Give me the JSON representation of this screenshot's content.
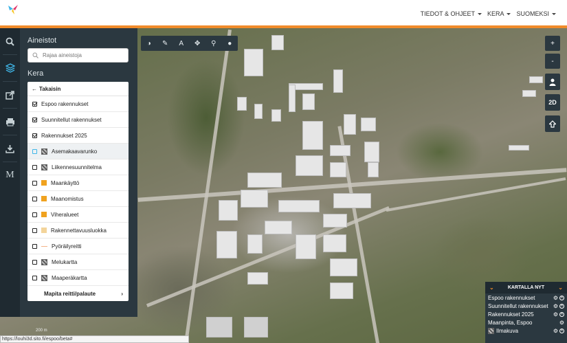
{
  "header": {
    "nav": [
      {
        "label": "TIEDOT & OHJEET"
      },
      {
        "label": "KERA"
      },
      {
        "label": "SUOMEKSI"
      }
    ],
    "accent_color": "#f18b2a"
  },
  "rail": {
    "items": [
      {
        "icon": "search-icon"
      },
      {
        "icon": "layers-icon",
        "active": true
      },
      {
        "icon": "share-icon"
      },
      {
        "icon": "print-icon"
      },
      {
        "icon": "download-icon"
      },
      {
        "icon": "metadata-icon",
        "glyph": "M"
      }
    ]
  },
  "panel": {
    "title": "Aineistot",
    "search_placeholder": "Rajaa aineistoja",
    "section": "Kera",
    "back_label": "Takaisin",
    "items": [
      {
        "label": "Espoo rakennukset",
        "checked": true,
        "legend": "none"
      },
      {
        "label": "Suunnitellut rakennukset",
        "checked": true,
        "legend": "none"
      },
      {
        "label": "Rakennukset 2025",
        "checked": true,
        "legend": "none"
      },
      {
        "label": "Asemakaavarunko",
        "checked": false,
        "legend": "image"
      },
      {
        "label": "Liikennesuunnitelma",
        "checked": false,
        "legend": "image"
      },
      {
        "label": "Maankäyttö",
        "checked": false,
        "legend": "swatch",
        "color": "#f0a21f"
      },
      {
        "label": "Maanomistus",
        "checked": false,
        "legend": "swatch",
        "color": "#f0a21f"
      },
      {
        "label": "Viheralueet",
        "checked": false,
        "legend": "swatch",
        "color": "#f0a21f"
      },
      {
        "label": "Rakennettavuusluokka",
        "checked": false,
        "legend": "swatch",
        "color": "#f3d49a"
      },
      {
        "label": "Pyöräilyreitti",
        "checked": false,
        "legend": "line",
        "color": "#f3b489"
      },
      {
        "label": "Melukartta",
        "checked": false,
        "legend": "image"
      },
      {
        "label": "Maaperäkartta",
        "checked": false,
        "legend": "image"
      }
    ],
    "footer_label": "Mapita reitti/palaute"
  },
  "map_tools": [
    {
      "icon": "contrast-icon",
      "glyph": "◑"
    },
    {
      "icon": "measure-icon",
      "glyph": "✎"
    },
    {
      "icon": "text-icon",
      "glyph": "A"
    },
    {
      "icon": "move-icon",
      "glyph": "✥"
    },
    {
      "icon": "pin-icon",
      "glyph": "⚲"
    },
    {
      "icon": "point-icon",
      "glyph": "●"
    }
  ],
  "map_controls": [
    {
      "name": "zoom-in-button",
      "glyph": "+"
    },
    {
      "name": "zoom-out-button",
      "glyph": "-"
    },
    {
      "name": "street-view-button",
      "glyph": "👤"
    },
    {
      "name": "view-mode-button",
      "glyph": "2D"
    },
    {
      "name": "home-button",
      "glyph": "⇧"
    }
  ],
  "kartalla_nyt": {
    "title": "KARTALLA NYT",
    "layers": [
      {
        "label": "Espoo rakennukset"
      },
      {
        "label": "Suunnitellut rakennukset"
      },
      {
        "label": "Rakennukset 2025"
      },
      {
        "label": "Maanpinta, Espoo"
      },
      {
        "label": "Ilmakuva"
      }
    ]
  },
  "status_url": "https://louhi3d.sito.fi/espoo/beta#",
  "attribution": "200 m"
}
